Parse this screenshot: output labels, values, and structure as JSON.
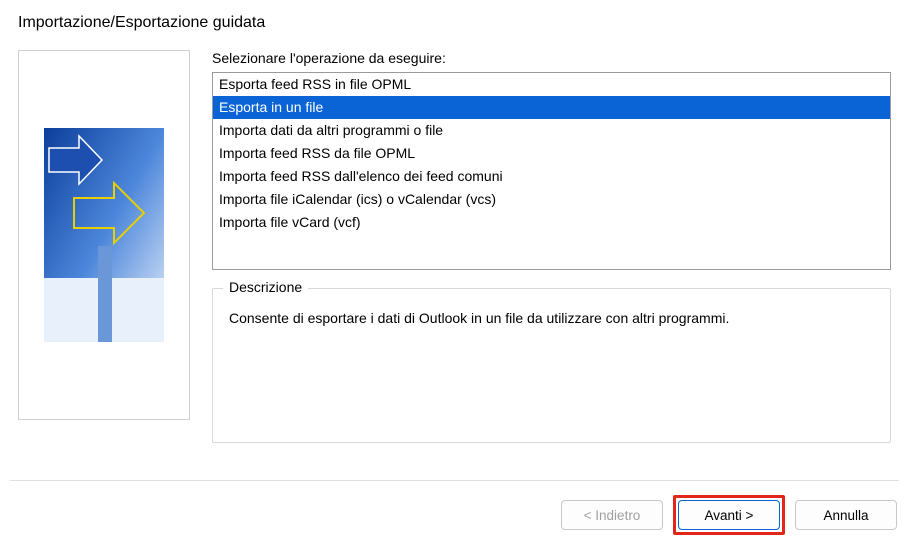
{
  "dialog": {
    "title": "Importazione/Esportazione guidata"
  },
  "list": {
    "label": "Selezionare l'operazione da eseguire:",
    "items": [
      "Esporta feed RSS in file OPML",
      "Esporta in un file",
      "Importa dati da altri programmi o file",
      "Importa feed RSS da file OPML",
      "Importa feed RSS dall'elenco dei feed comuni",
      "Importa file iCalendar (ics) o vCalendar (vcs)",
      "Importa file vCard (vcf)"
    ],
    "selected_index": 1
  },
  "description": {
    "legend": "Descrizione",
    "text": "Consente di esportare i dati di Outlook in un file da utilizzare con altri programmi."
  },
  "buttons": {
    "back": "< Indietro",
    "next": "Avanti >",
    "cancel": "Annulla"
  }
}
